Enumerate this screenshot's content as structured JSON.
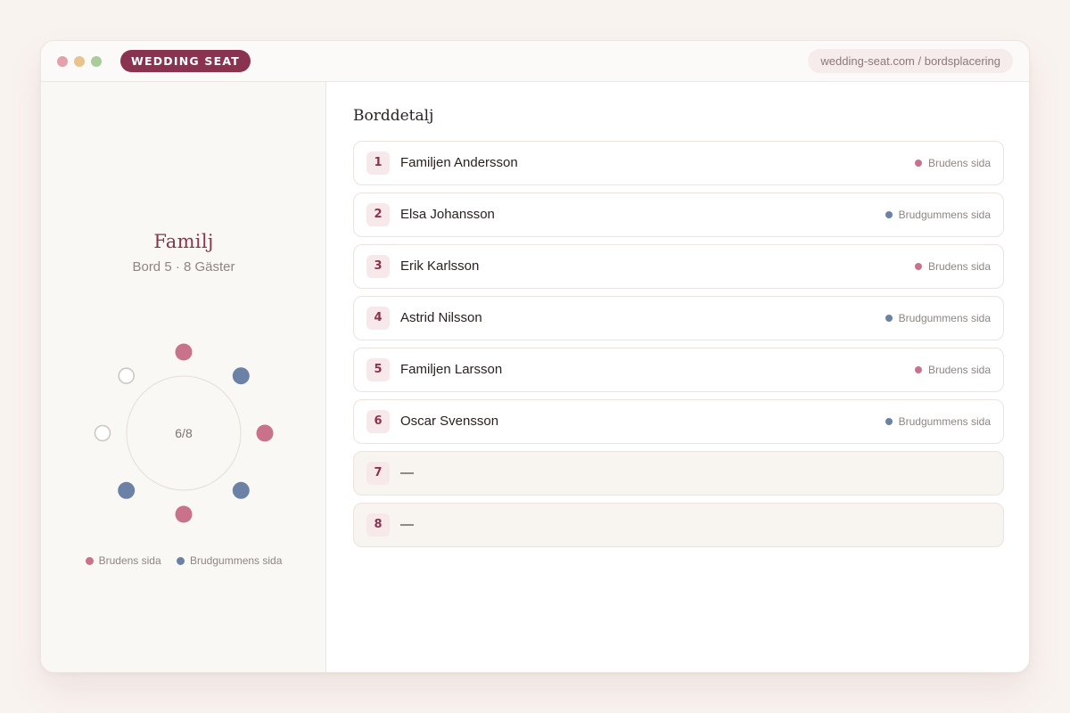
{
  "app": {
    "brand": "WEDDING SEAT",
    "url": "wedding-seat.com / bordsplacering",
    "window_dots": [
      "#e3a2a9",
      "#e7c48d",
      "#a9cc9a"
    ]
  },
  "colors": {
    "bride": "#c9728b",
    "groom": "#6b82a6",
    "accent": "#8a3350"
  },
  "table": {
    "name": "Familj",
    "subtitle": "Bord 5 · 8 Gäster",
    "occupancy": "6/8",
    "seats": [
      "bride",
      "groom",
      "bride",
      "groom",
      "bride",
      "groom",
      "empty",
      "empty"
    ]
  },
  "legend": {
    "bride_label": "Brudens sida",
    "groom_label": "Brudgummens sida"
  },
  "detail": {
    "title": "Borddetalj",
    "rows": [
      {
        "num": "1",
        "name": "Familjen Andersson",
        "side": "bride",
        "side_label": "Brudens sida"
      },
      {
        "num": "2",
        "name": "Elsa Johansson",
        "side": "groom",
        "side_label": "Brudgummens sida"
      },
      {
        "num": "3",
        "name": "Erik Karlsson",
        "side": "bride",
        "side_label": "Brudens sida"
      },
      {
        "num": "4",
        "name": "Astrid Nilsson",
        "side": "groom",
        "side_label": "Brudgummens sida"
      },
      {
        "num": "5",
        "name": "Familjen Larsson",
        "side": "bride",
        "side_label": "Brudens sida"
      },
      {
        "num": "6",
        "name": "Oscar Svensson",
        "side": "groom",
        "side_label": "Brudgummens sida"
      },
      {
        "num": "7",
        "name": "—",
        "side": "empty",
        "side_label": ""
      },
      {
        "num": "8",
        "name": "—",
        "side": "empty",
        "side_label": ""
      }
    ]
  }
}
